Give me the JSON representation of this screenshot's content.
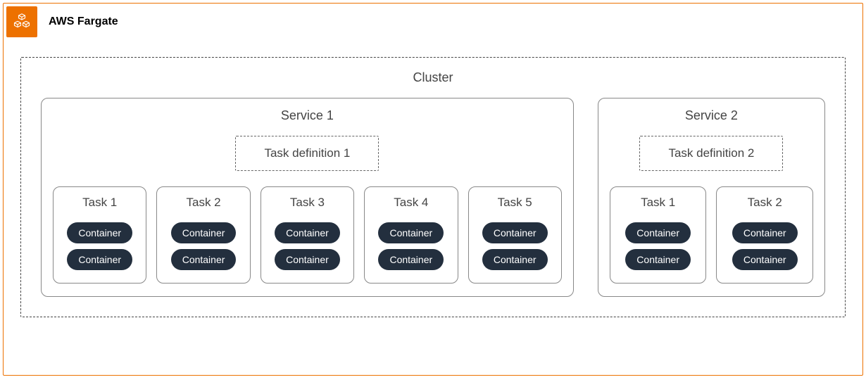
{
  "header": {
    "title": "AWS Fargate",
    "icon_name": "fargate-icon"
  },
  "cluster": {
    "label": "Cluster",
    "services": [
      {
        "name": "Service 1",
        "task_definition": "Task definition 1",
        "tasks": [
          {
            "name": "Task 1",
            "containers": [
              "Container",
              "Container"
            ]
          },
          {
            "name": "Task 2",
            "containers": [
              "Container",
              "Container"
            ]
          },
          {
            "name": "Task 3",
            "containers": [
              "Container",
              "Container"
            ]
          },
          {
            "name": "Task 4",
            "containers": [
              "Container",
              "Container"
            ]
          },
          {
            "name": "Task 5",
            "containers": [
              "Container",
              "Container"
            ]
          }
        ]
      },
      {
        "name": "Service 2",
        "task_definition": "Task definition 2",
        "tasks": [
          {
            "name": "Task 1",
            "containers": [
              "Container",
              "Container"
            ]
          },
          {
            "name": "Task 2",
            "containers": [
              "Container",
              "Container"
            ]
          }
        ]
      }
    ]
  }
}
